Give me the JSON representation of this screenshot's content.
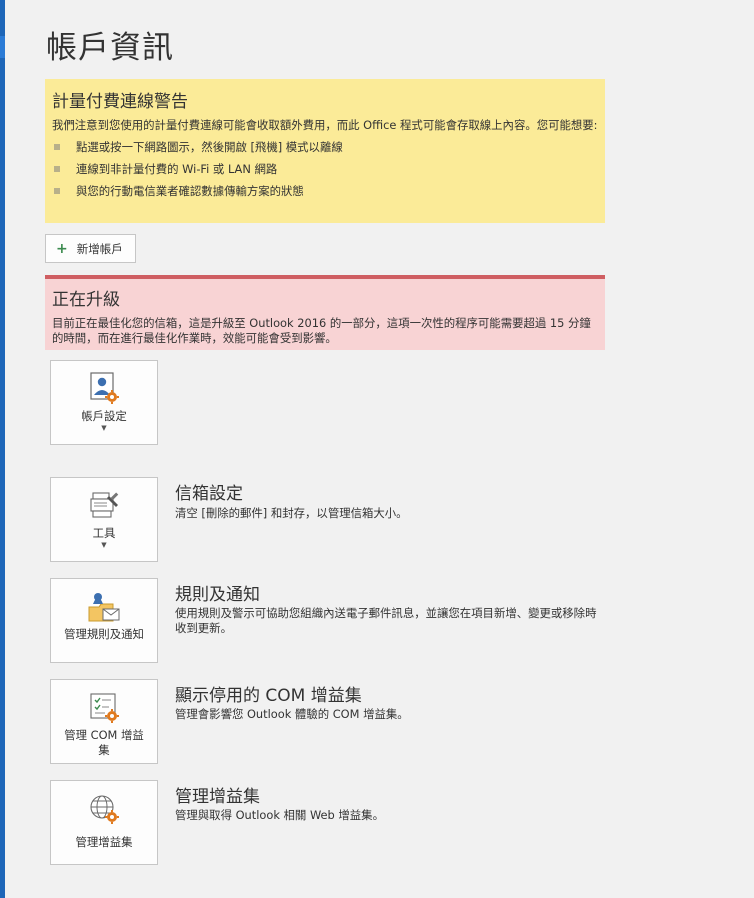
{
  "page": {
    "title": "帳戶資訊"
  },
  "metered_warning": {
    "title": "計量付費連線警告",
    "text": "我們注意到您使用的計量付費連線可能會收取額外費用，而此 Office 程式可能會存取線上內容。您可能想要:",
    "bullets": [
      "點選或按一下網路圖示，然後開啟 [飛機] 模式以離線",
      "連線到非計量付費的 Wi-Fi 或 LAN 網路",
      "與您的行動電信業者確認數據傳輸方案的狀態"
    ]
  },
  "add_account": {
    "label": "新增帳戶"
  },
  "upgrade": {
    "title": "正在升級",
    "text": "目前正在最佳化您的信箱，這是升級至 Outlook 2016 的一部分，這項一次性的程序可能需要超過 15 分鐘的時間，而在進行最佳化作業時，效能可能會受到影響。"
  },
  "tiles": {
    "account_settings": {
      "label": "帳戶設定"
    },
    "tools": {
      "label": "工具",
      "title": "信箱設定",
      "desc": "清空 [刪除的郵件] 和封存，以管理信箱大小。"
    },
    "rules": {
      "label": "管理規則及通知",
      "title": "規則及通知",
      "desc": "使用規則及警示可協助您組織內送電子郵件訊息，並讓您在項目新增、變更或移除時收到更新。"
    },
    "com": {
      "label": "管理 COM 增益集",
      "title": "顯示停用的 COM 增益集",
      "desc": "管理會影響您 Outlook 體驗的 COM 增益集。"
    },
    "addins": {
      "label": "管理增益集",
      "title": "管理增益集",
      "desc": "管理與取得 Outlook 相關 Web 增益集。"
    }
  },
  "colors": {
    "accent": "#1e66b8",
    "warning_bg": "#fbeb98",
    "upgrade_bg": "#f8d3d4",
    "upgrade_border": "#cf5e62",
    "gear": "#e07a1f"
  }
}
